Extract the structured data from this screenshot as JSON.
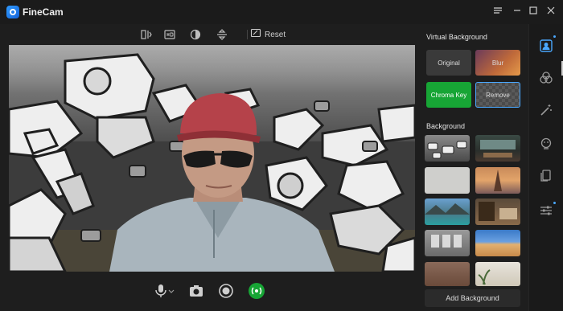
{
  "app": {
    "title": "FineCam"
  },
  "window_controls": [
    "menu-icon",
    "minimize-icon",
    "maximize-icon",
    "close-icon"
  ],
  "toolbar": {
    "icons": [
      "mirror-icon",
      "hd-icon",
      "contrast-icon",
      "flip-icon"
    ],
    "reset_label": "Reset"
  },
  "panel": {
    "virtual_title": "Virtual Background",
    "options": [
      {
        "label": "Original"
      },
      {
        "label": "Blur"
      },
      {
        "label": "Chroma Key"
      },
      {
        "label": "Remove"
      }
    ],
    "background_title": "Background",
    "add_label": "Add Background",
    "accent": "#4aa8ff",
    "chroma_color": "#17a535"
  },
  "controls": [
    "microphone-icon",
    "camera-icon",
    "record-icon",
    "live-icon"
  ],
  "rail": [
    "portrait-icon",
    "filter-icon",
    "magic-wand-icon",
    "face-icon",
    "layout-icon",
    "settings-sliders-icon"
  ]
}
